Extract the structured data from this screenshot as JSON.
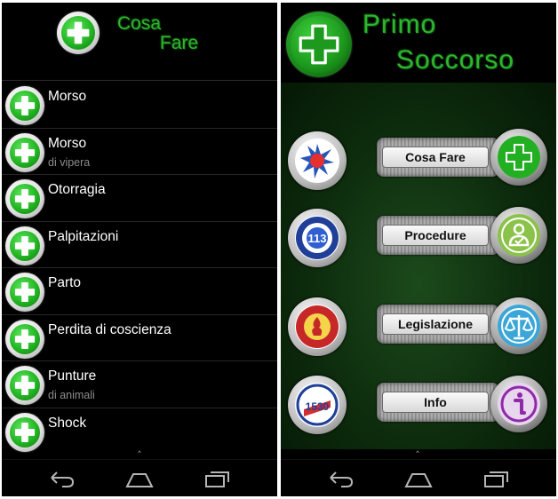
{
  "left_screen": {
    "header": {
      "title_line1": "Cosa",
      "title_line2": "Fare",
      "icon": "green-cross-icon"
    },
    "list": [
      {
        "title": "Morso",
        "subtitle": ""
      },
      {
        "title": "Morso",
        "subtitle": "di vipera"
      },
      {
        "title": "Otorragia",
        "subtitle": ""
      },
      {
        "title": "Palpitazioni",
        "subtitle": ""
      },
      {
        "title": "Parto",
        "subtitle": ""
      },
      {
        "title": "Perdita di coscienza",
        "subtitle": ""
      },
      {
        "title": "Punture",
        "subtitle": "di animali"
      },
      {
        "title": "Shock",
        "subtitle": ""
      }
    ],
    "nav": {
      "icons": [
        "back-icon",
        "home-icon",
        "recents-icon",
        "overflow-menu-icon"
      ]
    }
  },
  "right_screen": {
    "header": {
      "title_line1": "Primo",
      "title_line2": "Soccorso",
      "icon": "green-cross-icon"
    },
    "menu": [
      {
        "label": "Cosa Fare",
        "emblem": "118-emergency-emblem",
        "action_icon": "green-cross-icon",
        "action_color": "#22b022"
      },
      {
        "label": "Procedure",
        "emblem": "113-police-emblem",
        "action_icon": "procedure-person-icon",
        "action_color": "#8bc34a"
      },
      {
        "label": "Legislazione",
        "emblem": "vigili-del-fuoco-emblem",
        "action_icon": "scales-of-justice-icon",
        "action_color": "#3aa7d8"
      },
      {
        "label": "Info",
        "emblem": "1530-coast-guard-emblem",
        "action_icon": "info-icon",
        "action_color": "#8e2aa8"
      }
    ],
    "nav": {
      "icons": [
        "back-icon",
        "home-icon",
        "recents-icon",
        "overflow-menu-icon"
      ]
    }
  },
  "colors": {
    "title_green": "#2fb52f",
    "cross_green": "#23b523",
    "right_background": "#0d2c0d"
  }
}
